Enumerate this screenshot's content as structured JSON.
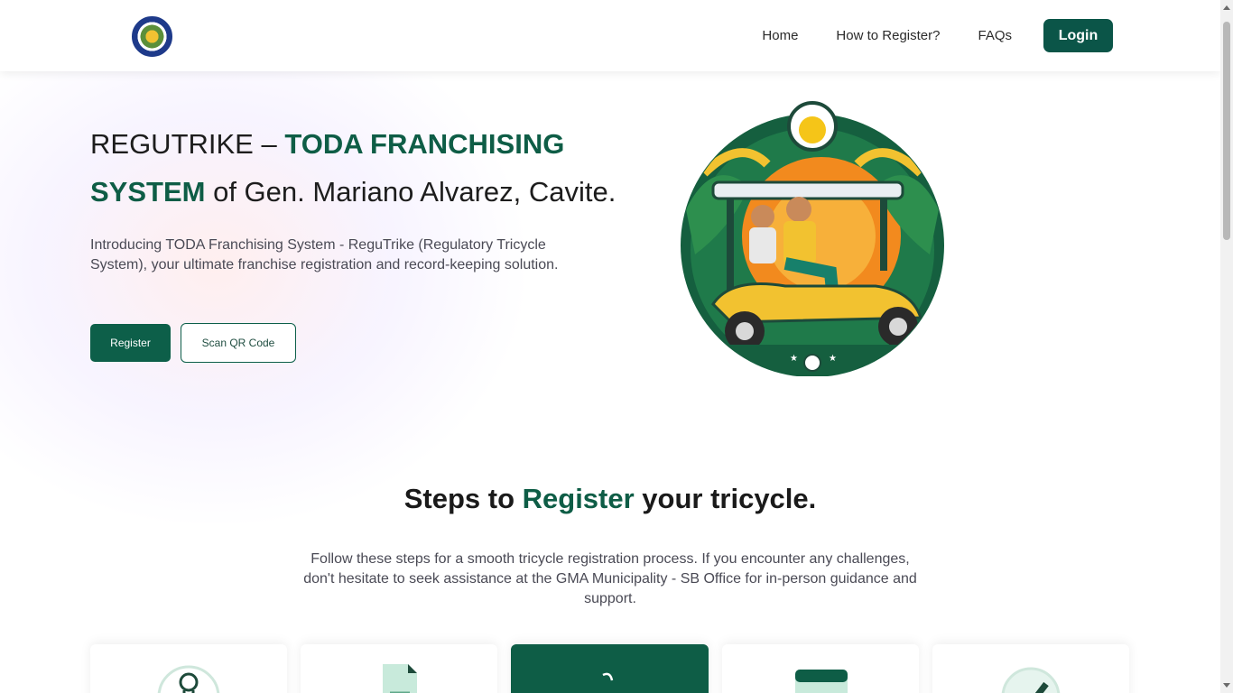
{
  "navbar": {
    "links": [
      "Home",
      "How to Register?",
      "FAQs"
    ],
    "login_label": "Login"
  },
  "hero": {
    "title_plain_1": "REGUTRIKE – ",
    "title_accent_1": "TODA FRANCHISING",
    "title_accent_2": "SYSTEM",
    "title_plain_2": " of Gen. Mariano Alvarez, Cavite.",
    "description": "Introducing TODA Franchising System - ReguTrike (Regulatory Tricycle System), your ultimate franchise registration and record-keeping solution.",
    "register_label": "Register",
    "scan_label": "Scan QR Code"
  },
  "steps": {
    "heading_prefix": "Steps to ",
    "heading_accent": "Register",
    "heading_suffix": " your tricycle.",
    "description": "Follow these steps for a smooth tricycle registration process. If you encounter any challenges, don't hesitate to seek assistance at the GMA Municipality - SB Office for in-person guidance and support.",
    "cards": [
      {
        "icon": "user-icon",
        "active": false
      },
      {
        "icon": "document-icon",
        "active": false
      },
      {
        "icon": "tricycle-icon",
        "active": true
      },
      {
        "icon": "calendar-icon",
        "active": false
      },
      {
        "icon": "check-icon",
        "active": false
      }
    ]
  },
  "colors": {
    "brand": "#0d5f49",
    "accent_text": "#0e5d46"
  }
}
